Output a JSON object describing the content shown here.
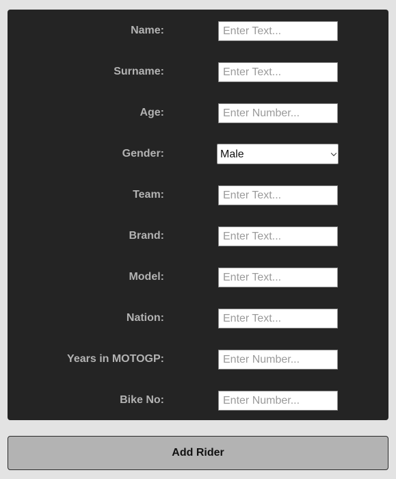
{
  "form": {
    "fields": [
      {
        "label": "Name:",
        "type": "text",
        "placeholder": "Enter Text...",
        "value": ""
      },
      {
        "label": "Surname:",
        "type": "text",
        "placeholder": "Enter Text...",
        "value": ""
      },
      {
        "label": "Age:",
        "type": "number",
        "placeholder": "Enter Number...",
        "value": ""
      },
      {
        "label": "Gender:",
        "type": "select",
        "selected": "Male"
      },
      {
        "label": "Team:",
        "type": "text",
        "placeholder": "Enter Text...",
        "value": ""
      },
      {
        "label": "Brand:",
        "type": "text",
        "placeholder": "Enter Text...",
        "value": ""
      },
      {
        "label": "Model:",
        "type": "text",
        "placeholder": "Enter Text...",
        "value": ""
      },
      {
        "label": "Nation:",
        "type": "text",
        "placeholder": "Enter Text...",
        "value": ""
      },
      {
        "label": "Years in MOTOGP:",
        "type": "number",
        "placeholder": "Enter Number...",
        "value": ""
      },
      {
        "label": "Bike No:",
        "type": "number",
        "placeholder": "Enter Number...",
        "value": ""
      }
    ]
  },
  "actions": {
    "add_rider_label": "Add Rider"
  },
  "icons": {
    "select_arrow": "chevron-down-icon"
  },
  "colors": {
    "page_background": "#e3e3e3",
    "panel_background": "#242424",
    "label_text": "#b3b3b3",
    "button_background": "#b3b3b3"
  }
}
